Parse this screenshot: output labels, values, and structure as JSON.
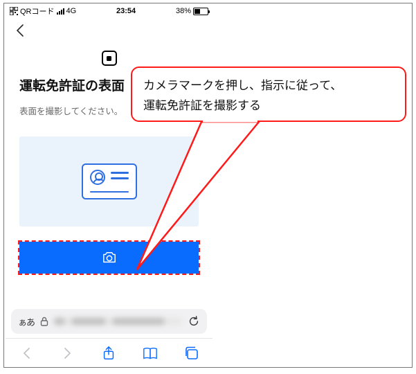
{
  "status": {
    "carrier_icon": "qr-code-icon",
    "carrier_text": "QRコード",
    "network": "4G",
    "time": "23:54",
    "battery_pct": "38%"
  },
  "page": {
    "title": "運転免許証の表面",
    "subtitle": "表面を撮影してください。"
  },
  "browser": {
    "text_size_label": "ぁあ"
  },
  "annotation": {
    "line1": "カメラマークを押し、指示に従って、",
    "line2": "運転免許証を撮影する"
  },
  "colors": {
    "accent": "#0a6cff",
    "annotation": "#ff1a1a",
    "illus_bg": "#eaf2fc",
    "illus_stroke": "#2f6fe0"
  }
}
